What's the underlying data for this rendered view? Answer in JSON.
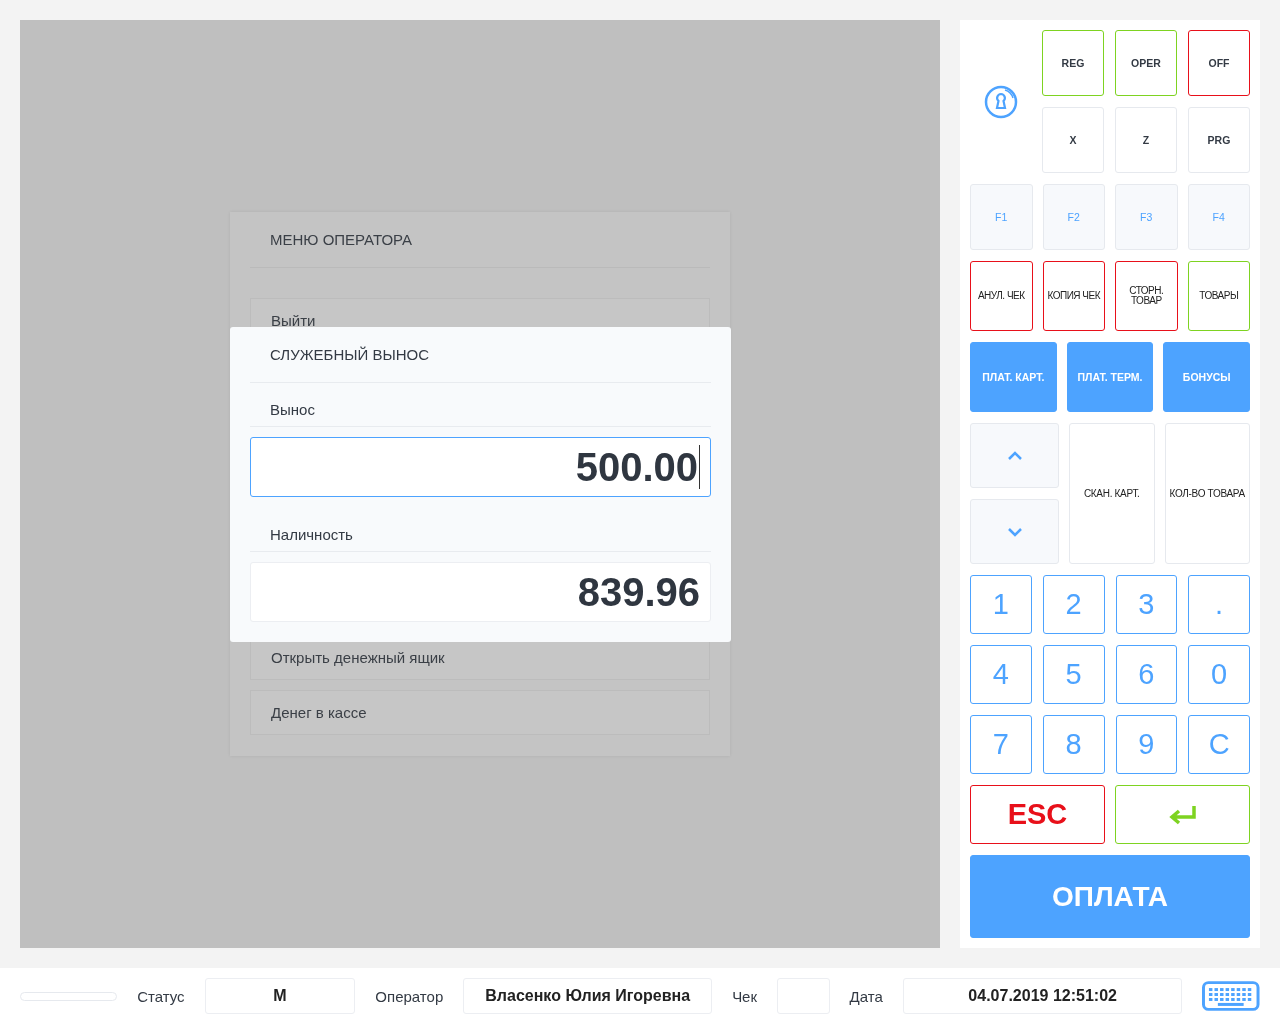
{
  "operator_menu": {
    "title": "МЕНЮ ОПЕРАТОРА",
    "items": [
      {
        "label": "Выйти"
      },
      {
        "label": "Открыть денежный ящик"
      },
      {
        "label": "Денег в кассе"
      }
    ]
  },
  "dialog": {
    "title": "СЛУЖЕБНЫЙ ВЫНОС",
    "fields": [
      {
        "label": "Вынос",
        "value": "500.00",
        "focused": true
      },
      {
        "label": "Наличность",
        "value": "839.96",
        "focused": false
      }
    ]
  },
  "keypad": {
    "mode_keys": [
      {
        "label": "REG",
        "color": "#7ed321"
      },
      {
        "label": "OPER",
        "color": "#7ed321"
      },
      {
        "label": "OFF",
        "color": "#e8101a"
      },
      {
        "label": "X"
      },
      {
        "label": "Z"
      },
      {
        "label": "PRG"
      }
    ],
    "function_keys": [
      "F1",
      "F2",
      "F3",
      "F4"
    ],
    "action_keys": [
      {
        "label": "АНУЛ. ЧЕК",
        "color": "#e8101a"
      },
      {
        "label": "КОПИЯ ЧЕК",
        "color": "#e8101a"
      },
      {
        "label": "СТОРН. ТОВАР",
        "color": "#e8101a"
      },
      {
        "label": "ТОВАРЫ",
        "color": "#7ed321"
      }
    ],
    "payment_keys": [
      "ПЛАТ. КАРТ.",
      "ПЛАТ. ТЕРМ.",
      "БОНУСЫ"
    ],
    "side_keys": [
      "СКАН. КАРТ.",
      "КОЛ-ВО ТОВАРА"
    ],
    "digit_keys": [
      "1",
      "2",
      "3",
      ".",
      "4",
      "5",
      "6",
      "0",
      "7",
      "8",
      "9",
      "C"
    ],
    "escape_key": "ESC",
    "pay_button": "ОПЛАТА"
  },
  "status_bar": {
    "status_label": "Статус",
    "status": "M",
    "operator_label": "Оператор",
    "operator": "Власенко Юлия Игоревна",
    "receipt_label": "Чек",
    "date_label": "Дата",
    "date": "04.07.2019 12:51:02"
  }
}
